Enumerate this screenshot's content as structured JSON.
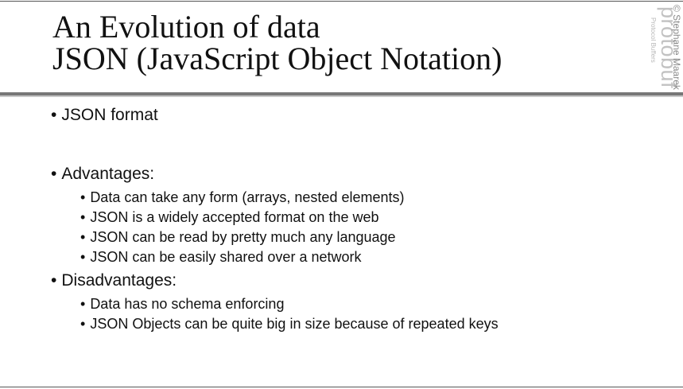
{
  "slide": {
    "title_line1": "An Evolution of data",
    "title_line2": "JSON (JavaScript Object Notation)",
    "brand": "protobuf",
    "brand_sub": "Protocol Buffers",
    "copyright": "© Stephane Maarek",
    "bullet_glyph": "•",
    "bullets": {
      "format": "JSON format",
      "advantages": "Advantages:",
      "advantages_items": [
        "Data can take any form (arrays, nested elements)",
        "JSON is a widely accepted format on the web",
        "JSON can be read by pretty much any language",
        "JSON can be easily shared over a network"
      ],
      "disadvantages": "Disadvantages:",
      "disadvantages_items": [
        "Data has no schema enforcing",
        "JSON Objects can be quite big in size because of repeated keys"
      ]
    }
  }
}
